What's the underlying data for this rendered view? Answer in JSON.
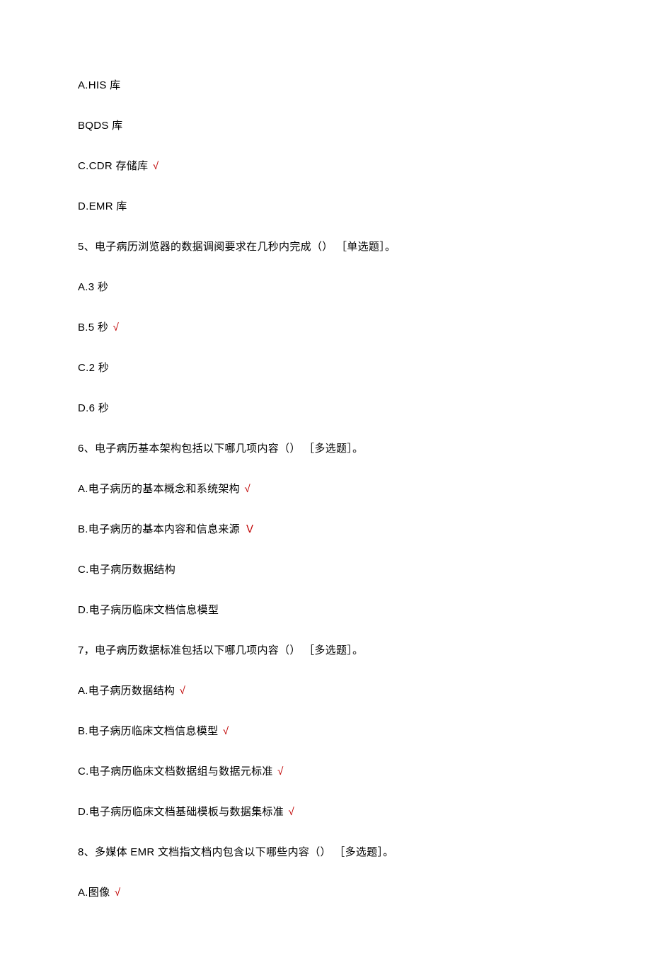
{
  "lines": [
    {
      "text": "A.HIS 库",
      "correct": false
    },
    {
      "text": "BQDS 库",
      "correct": false
    },
    {
      "text": "C.CDR 存储库",
      "correct": true
    },
    {
      "text": "D.EMR 库",
      "correct": false
    },
    {
      "text": "5、电子病历浏览器的数据调阅要求在几秒内完成（） ［单选题］。",
      "correct": false
    },
    {
      "text": "A.3 秒",
      "correct": false
    },
    {
      "text": "B.5 秒",
      "correct": true
    },
    {
      "text": "C.2 秒",
      "correct": false
    },
    {
      "text": "D.6 秒",
      "correct": false
    },
    {
      "text": "6、电子病历基本架构包括以下哪几项内容（） ［多选题］。",
      "correct": false
    },
    {
      "text": "A.电子病历的基本概念和系统架构",
      "correct": true
    },
    {
      "text": "B.电子病历的基本内容和信息来源",
      "correct": true,
      "checkGlyph": "Ｖ"
    },
    {
      "text": "C.电子病历数据结构",
      "correct": false
    },
    {
      "text": "D.电子病历临床文档信息模型",
      "correct": false
    },
    {
      "text": "7，电子病历数据标准包括以下哪几项内容（） ［多选题］。",
      "correct": false
    },
    {
      "text": "A.电子病历数据结构",
      "correct": true
    },
    {
      "text": "B.电子病历临床文档信息模型",
      "correct": true
    },
    {
      "text": "C.电子病历临床文档数据组与数据元标准",
      "correct": true
    },
    {
      "text": "D.电子病历临床文档基础模板与数据集标准",
      "correct": true
    },
    {
      "text": "8、多媒体 EMR 文档指文档内包含以下哪些内容（） ［多选题］。",
      "correct": false
    },
    {
      "text": "A.图像",
      "correct": true
    }
  ],
  "defaultCheckGlyph": "√"
}
